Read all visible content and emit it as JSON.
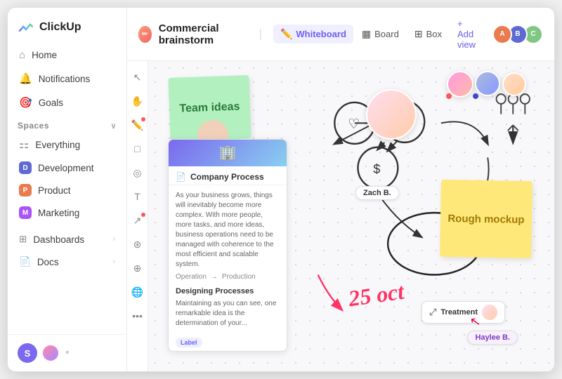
{
  "app": {
    "name": "ClickUp"
  },
  "sidebar": {
    "nav": [
      {
        "label": "Home",
        "icon": "⌂",
        "id": "home"
      },
      {
        "label": "Notifications",
        "icon": "🔔",
        "id": "notifications"
      },
      {
        "label": "Goals",
        "icon": "🎯",
        "id": "goals"
      }
    ],
    "spaces_label": "Spaces",
    "spaces": [
      {
        "label": "Everything",
        "id": "everything",
        "color": "transparent",
        "letter": "⚏"
      },
      {
        "label": "Development",
        "id": "development",
        "color": "#5e6ad2",
        "letter": "D"
      },
      {
        "label": "Product",
        "id": "product",
        "color": "#e97b4e",
        "letter": "P"
      },
      {
        "label": "Marketing",
        "id": "marketing",
        "color": "#a855f7",
        "letter": "M"
      }
    ],
    "bottom": [
      {
        "label": "Dashboards",
        "id": "dashboards"
      },
      {
        "label": "Docs",
        "id": "docs"
      }
    ],
    "footer": {
      "initials": "S"
    }
  },
  "topbar": {
    "title": "Commercial brainstorm",
    "tabs": [
      {
        "label": "Whiteboard",
        "active": true,
        "icon": "✏️"
      },
      {
        "label": "Board",
        "active": false,
        "icon": "▦"
      },
      {
        "label": "Box",
        "active": false,
        "icon": "⊞"
      }
    ],
    "add_view": "+ Add view"
  },
  "canvas": {
    "sticky_green": "Team ideas",
    "sticky_yellow": "Rough mockup",
    "zach_chip": "Zach B.",
    "treatment_chip": "Treatment",
    "haylee_chip": "Haylee B.",
    "oct_label": "25 oct",
    "card": {
      "title": "Company Process",
      "banner_text": "🏢",
      "body_text": "As your business grows, things will inevitably become more complex. With more people, more tasks, and more ideas, business operations need to be managed with coherence to the most efficient and scalable system.",
      "row1_left": "Operation",
      "row1_right": "Production",
      "section": "Designing Processes",
      "section_body": "Maintaining as you can see, one remarkable idea is the determination of your...",
      "label": "Label"
    }
  },
  "toolbar": {
    "tools": [
      "↖",
      "✋",
      "✏️",
      "□",
      "◎",
      "T",
      "↗",
      "⊛",
      "⊕",
      "🌐",
      "•••"
    ]
  }
}
